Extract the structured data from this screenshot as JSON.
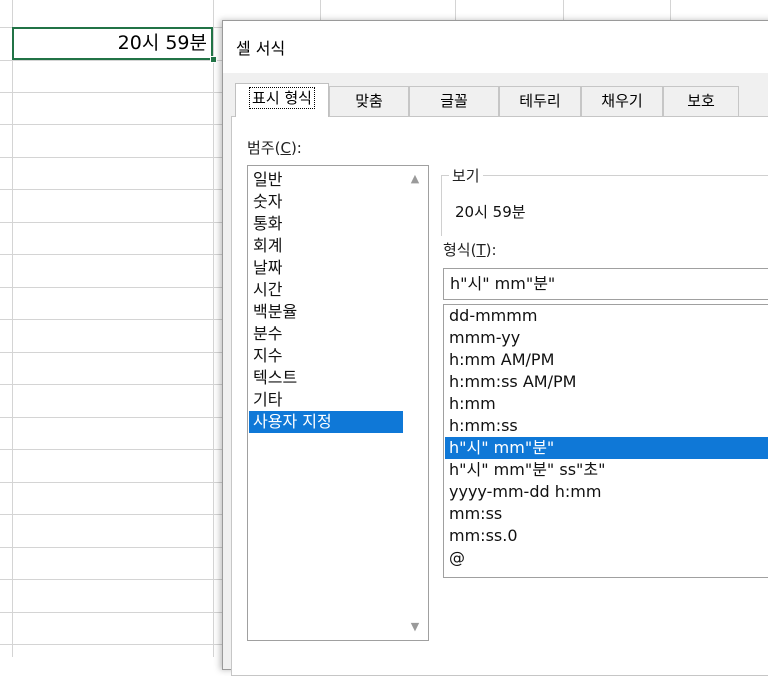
{
  "cell": {
    "value": "20시 59분"
  },
  "dialog": {
    "title": "셀 서식",
    "tabs": [
      {
        "label": "표시 형식"
      },
      {
        "label": "맞춤"
      },
      {
        "label": "글꼴"
      },
      {
        "label": "테두리"
      },
      {
        "label": "채우기"
      },
      {
        "label": "보호"
      }
    ],
    "category": {
      "label_text": "범주(",
      "label_key": "C",
      "label_end": "):",
      "items": [
        "일반",
        "숫자",
        "통화",
        "회계",
        "날짜",
        "시간",
        "백분율",
        "분수",
        "지수",
        "텍스트",
        "기타",
        "사용자 지정"
      ],
      "selected": "사용자 지정"
    },
    "sample": {
      "legend": "보기",
      "value": "20시 59분"
    },
    "format": {
      "label_text": "형식(",
      "label_key": "T",
      "label_end": "):",
      "input_value": "h\"시\" mm\"분\"",
      "items": [
        "dd-mmmm",
        "mmm-yy",
        "h:mm AM/PM",
        "h:mm:ss AM/PM",
        "h:mm",
        "h:mm:ss",
        "h\"시\" mm\"분\"",
        "h\"시\" mm\"분\" ss\"초\"",
        "yyyy-mm-dd h:mm",
        "mm:ss",
        "mm:ss.0",
        "@"
      ],
      "selected": "h\"시\" mm\"분\""
    }
  },
  "icons": {
    "scroll_up": "chevron-up-icon",
    "scroll_down": "chevron-down-icon"
  },
  "colors": {
    "selection": "#0f78d7",
    "cell_border": "#217346"
  }
}
